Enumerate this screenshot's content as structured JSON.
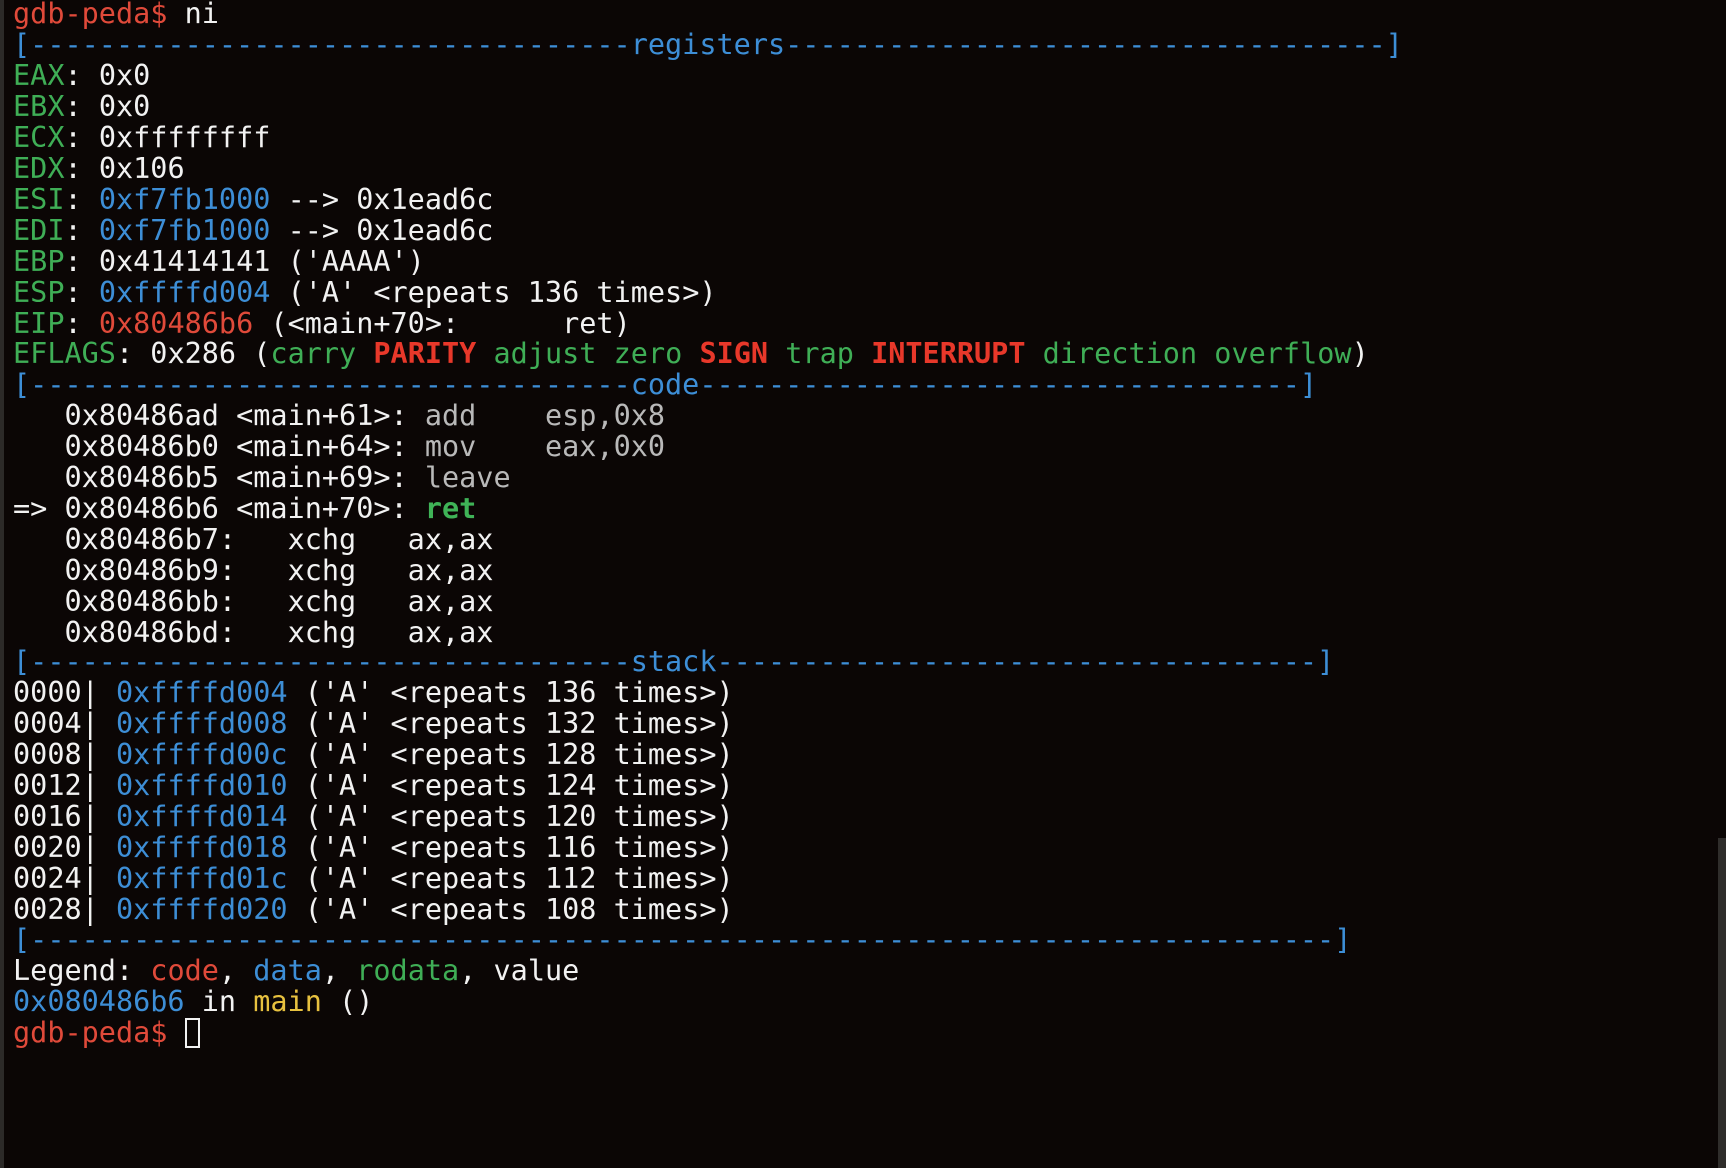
{
  "prompt": "gdb-peda$",
  "command": "ni",
  "sections": {
    "registers": "[-----------------------------------registers-----------------------------------]",
    "code": "[-----------------------------------code-----------------------------------]",
    "stack": "[-----------------------------------stack-----------------------------------]",
    "end": "[----------------------------------------------------------------------------]"
  },
  "registers": [
    {
      "name": "EAX",
      "value": "0x0",
      "value_color": "white",
      "rest": ""
    },
    {
      "name": "EBX",
      "value": "0x0",
      "value_color": "white",
      "rest": ""
    },
    {
      "name": "ECX",
      "value": "0xffffffff",
      "value_color": "white",
      "rest": ""
    },
    {
      "name": "EDX",
      "value": "0x106",
      "value_color": "white",
      "rest": ""
    },
    {
      "name": "ESI",
      "value": "0xf7fb1000",
      "value_color": "blue",
      "rest": " --> 0x1ead6c"
    },
    {
      "name": "EDI",
      "value": "0xf7fb1000",
      "value_color": "blue",
      "rest": " --> 0x1ead6c"
    },
    {
      "name": "EBP",
      "value": "0x41414141",
      "value_color": "white",
      "rest": " ('AAAA')"
    },
    {
      "name": "ESP",
      "value": "0xffffd004",
      "value_color": "blue",
      "rest": " ('A' <repeats 136 times>)"
    },
    {
      "name": "EIP",
      "value": "0x80486b6",
      "value_color": "red",
      "rest": " (<main+70>:\tret)"
    }
  ],
  "eflags": {
    "name": "EFLAGS",
    "value": "0x286",
    "flags": [
      {
        "text": "carry",
        "set": false
      },
      {
        "text": "PARITY",
        "set": true
      },
      {
        "text": "adjust",
        "set": false
      },
      {
        "text": "zero",
        "set": false
      },
      {
        "text": "SIGN",
        "set": true
      },
      {
        "text": "trap",
        "set": false
      },
      {
        "text": "INTERRUPT",
        "set": true
      },
      {
        "text": "direction",
        "set": false
      },
      {
        "text": "overflow",
        "set": false
      }
    ]
  },
  "code": [
    {
      "prefix": "   ",
      "addr": "0x80486ad",
      "sym": " <main+61>: ",
      "mnem": "add",
      "ops": "    esp,0x8",
      "current": false,
      "dim": true
    },
    {
      "prefix": "   ",
      "addr": "0x80486b0",
      "sym": " <main+64>: ",
      "mnem": "mov",
      "ops": "    eax,0x0",
      "current": false,
      "dim": true
    },
    {
      "prefix": "   ",
      "addr": "0x80486b5",
      "sym": " <main+69>: ",
      "mnem": "leave",
      "ops": "",
      "current": false,
      "dim": true
    },
    {
      "prefix": "=> ",
      "addr": "0x80486b6",
      "sym": " <main+70>: ",
      "mnem": "ret",
      "ops": "",
      "current": true,
      "dim": false
    },
    {
      "prefix": "   ",
      "addr": "0x80486b7",
      "sym": ":   ",
      "mnem": "xchg",
      "ops": "   ax,ax",
      "current": false,
      "dim": false
    },
    {
      "prefix": "   ",
      "addr": "0x80486b9",
      "sym": ":   ",
      "mnem": "xchg",
      "ops": "   ax,ax",
      "current": false,
      "dim": false
    },
    {
      "prefix": "   ",
      "addr": "0x80486bb",
      "sym": ":   ",
      "mnem": "xchg",
      "ops": "   ax,ax",
      "current": false,
      "dim": false
    },
    {
      "prefix": "   ",
      "addr": "0x80486bd",
      "sym": ":   ",
      "mnem": "xchg",
      "ops": "   ax,ax",
      "current": false,
      "dim": false
    }
  ],
  "stack": [
    {
      "offset": "0000",
      "addr": "0xffffd004",
      "content": " ('A' <repeats 136 times>)"
    },
    {
      "offset": "0004",
      "addr": "0xffffd008",
      "content": " ('A' <repeats 132 times>)"
    },
    {
      "offset": "0008",
      "addr": "0xffffd00c",
      "content": " ('A' <repeats 128 times>)"
    },
    {
      "offset": "0012",
      "addr": "0xffffd010",
      "content": " ('A' <repeats 124 times>)"
    },
    {
      "offset": "0016",
      "addr": "0xffffd014",
      "content": " ('A' <repeats 120 times>)"
    },
    {
      "offset": "0020",
      "addr": "0xffffd018",
      "content": " ('A' <repeats 116 times>)"
    },
    {
      "offset": "0024",
      "addr": "0xffffd01c",
      "content": " ('A' <repeats 112 times>)"
    },
    {
      "offset": "0028",
      "addr": "0xffffd020",
      "content": " ('A' <repeats 108 times>)"
    }
  ],
  "legend": {
    "label": "Legend: ",
    "items": [
      {
        "text": "code",
        "color": "red"
      },
      {
        "text": "data",
        "color": "blue"
      },
      {
        "text": "rodata",
        "color": "green"
      },
      {
        "text": "value",
        "color": "white"
      }
    ]
  },
  "location": {
    "addr": "0x080486b6",
    "in": " in ",
    "func": "main",
    "tail": " ()"
  },
  "colors": {
    "background": "#0b0605",
    "prompt": "#e04a3a",
    "register_name": "#3fae56",
    "data": "#3d8ed6",
    "code": "#e04a3a",
    "function": "#e7c13f"
  }
}
